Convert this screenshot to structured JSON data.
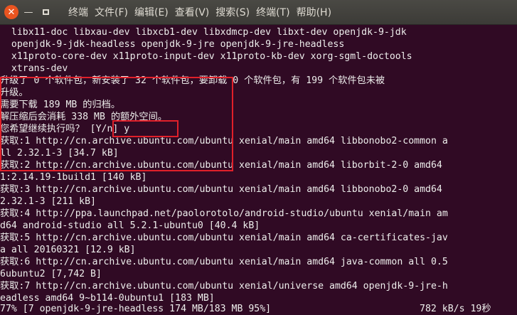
{
  "window": {
    "title_menu": [
      "终端",
      "文件(F)",
      "编辑(E)",
      "查看(V)",
      "搜索(S)",
      "终端(T)",
      "帮助(H)"
    ],
    "close_symbol": "✕",
    "minimize_symbol": "—"
  },
  "terminal": {
    "lines": [
      "  libx11-doc libxau-dev libxcb1-dev libxdmcp-dev libxt-dev openjdk-9-jdk",
      "  openjdk-9-jdk-headless openjdk-9-jre openjdk-9-jre-headless",
      "  x11proto-core-dev x11proto-input-dev x11proto-kb-dev xorg-sgml-doctools",
      "  xtrans-dev",
      "升级了 0 个软件包，新安装了 32 个软件包，要卸载 0 个软件包，有 199 个软件包未被",
      "升级。",
      "需要下载 189 MB 的归档。",
      "解压缩后会消耗 338 MB 的额外空间。",
      "您希望继续执行吗？ [Y/n] y",
      "获取:1 http://cn.archive.ubuntu.com/ubuntu xenial/main amd64 libbonobo2-common a",
      "ll 2.32.1-3 [34.7 kB]",
      "获取:2 http://cn.archive.ubuntu.com/ubuntu xenial/main amd64 liborbit-2-0 amd64",
      "1:2.14.19-1build1 [140 kB]",
      "获取:3 http://cn.archive.ubuntu.com/ubuntu xenial/main amd64 libbonobo2-0 amd64",
      "2.32.1-3 [211 kB]",
      "获取:4 http://ppa.launchpad.net/paolorotolo/android-studio/ubuntu xenial/main am",
      "d64 android-studio all 5.2.1-ubuntu0 [40.4 kB]",
      "获取:5 http://cn.archive.ubuntu.com/ubuntu xenial/main amd64 ca-certificates-jav",
      "a all 20160321 [12.9 kB]",
      "获取:6 http://cn.archive.ubuntu.com/ubuntu xenial/main amd64 java-common all 0.5",
      "6ubuntu2 [7,742 B]",
      "获取:7 http://cn.archive.ubuntu.com/ubuntu xenial/universe amd64 openjdk-9-jre-h",
      "eadless amd64 9~b114-0ubuntu1 [183 MB]"
    ],
    "status_line_left": "77% [7 openjdk-9-jre-headless 174 MB/183 MB 95%]",
    "status_line_right": "782 kB/s 19秒"
  },
  "colors": {
    "terminal_bg": "#300a24",
    "text": "#eeeeec",
    "highlight": "#e0202a",
    "close_button": "#e95420"
  }
}
